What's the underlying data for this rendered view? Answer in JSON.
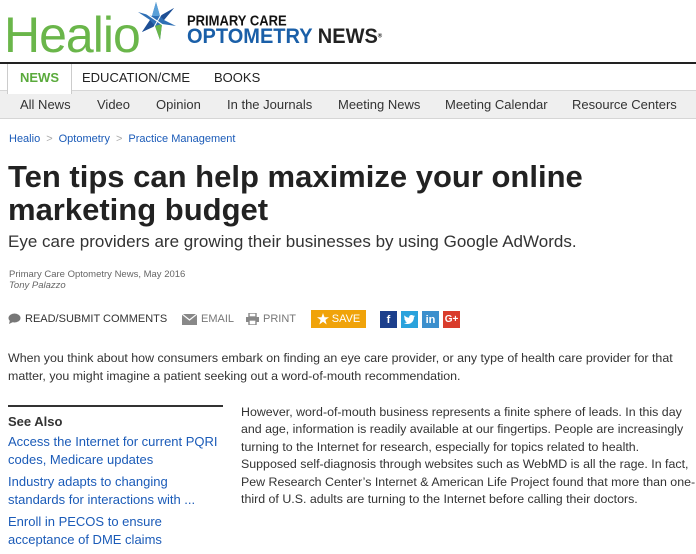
{
  "header": {
    "brand": "Healio",
    "publication_top": "PRIMARY CARE",
    "publication_bottom_1": "OPTOMETRY",
    "publication_bottom_2": "NEWS",
    "publication_mark": "®",
    "colors": {
      "brand_green": "#6ab64a",
      "brand_blue": "#1a5fa8"
    }
  },
  "topnav": {
    "items": [
      {
        "label": "NEWS",
        "active": true
      },
      {
        "label": "EDUCATION/CME",
        "active": false
      },
      {
        "label": "BOOKS",
        "active": false
      }
    ]
  },
  "subnav": {
    "items": [
      {
        "label": "All News"
      },
      {
        "label": "Video"
      },
      {
        "label": "Opinion"
      },
      {
        "label": "In the Journals"
      },
      {
        "label": "Meeting News"
      },
      {
        "label": "Meeting Calendar"
      },
      {
        "label": "Resource Centers"
      }
    ]
  },
  "breadcrumb": {
    "items": [
      "Healio",
      "Optometry",
      "Practice Management"
    ],
    "separator": ">"
  },
  "article": {
    "title": "Ten tips can help maximize your online marketing budget",
    "subtitle": "Eye care providers are growing their businesses by using Google AdWords.",
    "source": "Primary Care Optometry News, May 2016",
    "author": "Tony Palazzo",
    "intro": "When you think about how consumers embark on finding an eye care provider, or any type of health care provider for that matter, you might imagine a patient seeking out a word-of-mouth recommendation.",
    "body": "However, word-of-mouth business represents a finite sphere of leads. In this day and age, information is readily available at our fingertips. People are increasingly turning to the Internet for research, especially for topics related to health. Supposed self-diagnosis through websites such as WebMD is all the rage. In fact, Pew Research Center’s Internet & American Life Project found that more than one-third of U.S. adults are turning to the Internet before calling their doctors."
  },
  "actions": {
    "comments": "READ/SUBMIT COMMENTS",
    "email": "EMAIL",
    "print": "PRINT",
    "save": "SAVE",
    "social": {
      "facebook": "f",
      "twitter": "t",
      "linkedin": "in",
      "googleplus": "G+"
    },
    "colors": {
      "save_bg": "#f0a30a"
    }
  },
  "see_also": {
    "title": "See Also",
    "links": [
      "Access the Internet for current PQRI codes, Medicare updates",
      "Industry adapts to changing standards for interactions with ...",
      "Enroll in PECOS to ensure acceptance of DME claims"
    ]
  }
}
